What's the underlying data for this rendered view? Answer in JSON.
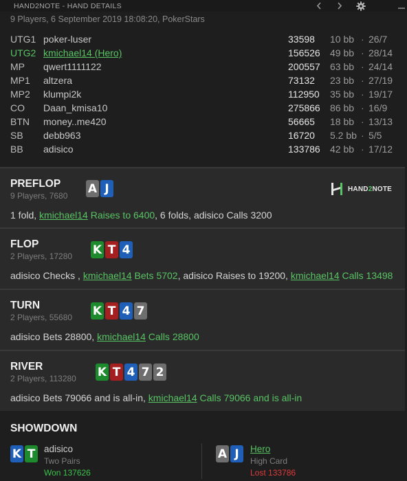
{
  "window": {
    "title": "HAND2NOTE - HAND DETAILS"
  },
  "subtitle": "9 Players, 6 September 2019 18:08:20, PokerStars",
  "players": [
    {
      "pos": "UTG1",
      "name": "poker-luser",
      "stack": "33598",
      "bb": "10 bb",
      "ratio": "26/7"
    },
    {
      "pos": "UTG2",
      "name": "kmichael14 (Hero)",
      "stack": "156526",
      "bb": "49 bb",
      "ratio": "28/14"
    },
    {
      "pos": "MP",
      "name": "qwert1111122",
      "stack": "200557",
      "bb": "63 bb",
      "ratio": "24/14"
    },
    {
      "pos": "MP1",
      "name": "altzera",
      "stack": "73132",
      "bb": "23 bb",
      "ratio": "27/19"
    },
    {
      "pos": "MP2",
      "name": "klumpi2k",
      "stack": "112950",
      "bb": "35 bb",
      "ratio": "19/17"
    },
    {
      "pos": "CO",
      "name": "Daan_kmisa10",
      "stack": "275866",
      "bb": "86 bb",
      "ratio": "16/9"
    },
    {
      "pos": "BTN",
      "name": "money..me420",
      "stack": "56665",
      "bb": "18 bb",
      "ratio": "13/13"
    },
    {
      "pos": "SB",
      "name": "debb963",
      "stack": "16720",
      "bb": "5.2 bb",
      "ratio": "5/5"
    },
    {
      "pos": "BB",
      "name": "adisico",
      "stack": "133786",
      "bb": "42 bb",
      "ratio": "17/12"
    }
  ],
  "dot": "·",
  "logo": {
    "prefix": "HAND",
    "two": "2",
    "suffix": "NOTE"
  },
  "streets": {
    "preflop": {
      "title": "PREFLOP",
      "sub": "9 Players, 7680",
      "cards": [
        {
          "rank": "A",
          "color": "grey"
        },
        {
          "rank": "J",
          "color": "blue"
        }
      ],
      "actions": [
        {
          "text": "1 fold, ",
          "type": "plain"
        },
        {
          "text": "kmichael14",
          "type": "hero-name"
        },
        {
          "text": " Raises to 6400",
          "type": "hero"
        },
        {
          "text": ", 6 folds, adisico ",
          "type": "plain"
        },
        {
          "text": "Calls 3200",
          "type": "plain"
        }
      ]
    },
    "flop": {
      "title": "FLOP",
      "sub": "2 Players, 17280",
      "cards": [
        {
          "rank": "K",
          "color": "green"
        },
        {
          "rank": "T",
          "color": "red"
        },
        {
          "rank": "4",
          "color": "blue"
        }
      ],
      "actions": [
        {
          "text": "adisico Checks , ",
          "type": "plain"
        },
        {
          "text": "kmichael14",
          "type": "hero-name"
        },
        {
          "text": " Bets 5702",
          "type": "hero"
        },
        {
          "text": ", adisico Raises to 19200, ",
          "type": "plain"
        },
        {
          "text": "kmichael14",
          "type": "hero-name"
        },
        {
          "text": " Calls 13498",
          "type": "hero"
        }
      ]
    },
    "turn": {
      "title": "TURN",
      "sub": "2 Players, 55680",
      "cards": [
        {
          "rank": "K",
          "color": "green"
        },
        {
          "rank": "T",
          "color": "red"
        },
        {
          "rank": "4",
          "color": "blue"
        },
        {
          "rank": "7",
          "color": "grey"
        }
      ],
      "actions": [
        {
          "text": "adisico Bets 28800, ",
          "type": "plain"
        },
        {
          "text": "kmichael14",
          "type": "hero-name"
        },
        {
          "text": " Calls 28800",
          "type": "hero"
        }
      ]
    },
    "river": {
      "title": "RIVER",
      "sub": "2 Players, 113280",
      "cards": [
        {
          "rank": "K",
          "color": "green"
        },
        {
          "rank": "T",
          "color": "red"
        },
        {
          "rank": "4",
          "color": "blue"
        },
        {
          "rank": "7",
          "color": "grey"
        },
        {
          "rank": "2",
          "color": "grey"
        }
      ],
      "actions": [
        {
          "text": "adisico Bets 79066 and is all-in, ",
          "type": "plain"
        },
        {
          "text": "kmichael14",
          "type": "hero-name"
        },
        {
          "text": " Calls 79066 and is all-in",
          "type": "hero"
        }
      ]
    }
  },
  "showdown": {
    "title": "SHOWDOWN",
    "left": {
      "name": "adisico",
      "hand": "Two Pairs",
      "result": "Won 137626",
      "cards": [
        {
          "rank": "K",
          "color": "blue"
        },
        {
          "rank": "T",
          "color": "green"
        }
      ]
    },
    "right": {
      "name": "Hero",
      "hand": "High Card",
      "result": "Lost 133786",
      "cards": [
        {
          "rank": "A",
          "color": "grey"
        },
        {
          "rank": "J",
          "color": "blue"
        }
      ]
    }
  },
  "colors": {
    "hero": "#58c464",
    "won": "#3cc24c",
    "lost": "#e03a3a",
    "card_green": "#1d8a2d",
    "card_red": "#a42020",
    "card_blue": "#1f5fb8",
    "card_grey": "#6e6e6e"
  },
  "icons": [
    "chevron-left-icon",
    "chevron-right-icon",
    "gear-icon",
    "minimize-icon",
    "hand2note-logo-icon"
  ]
}
